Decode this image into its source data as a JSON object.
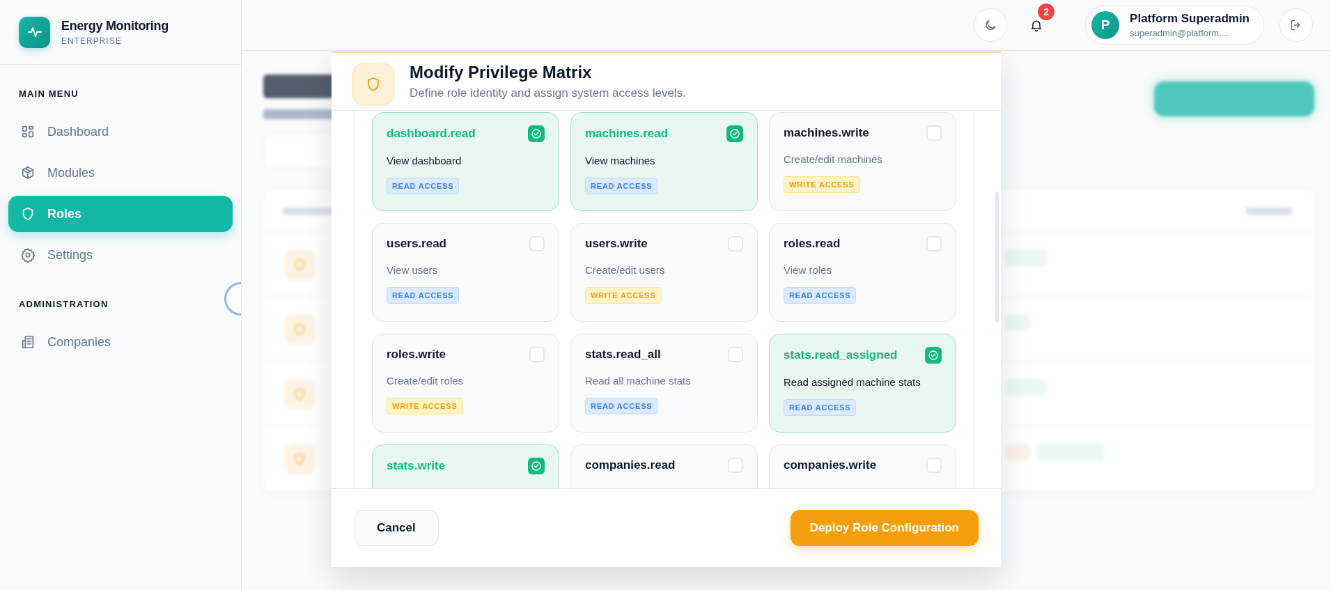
{
  "brand": {
    "title": "Energy Monitoring",
    "subtitle": "ENTERPRISE"
  },
  "sidebar": {
    "sections": [
      {
        "title": "MAIN MENU",
        "items": [
          {
            "label": "Dashboard",
            "selected": false
          },
          {
            "label": "Modules",
            "selected": false
          },
          {
            "label": "Roles",
            "selected": true
          },
          {
            "label": "Settings",
            "selected": false
          }
        ]
      },
      {
        "title": "ADMINISTRATION",
        "items": [
          {
            "label": "Companies",
            "selected": false
          }
        ]
      }
    ]
  },
  "header": {
    "notifications": "2",
    "user": {
      "initial": "P",
      "name": "Platform Superadmin",
      "email": "superadmin@platform...."
    }
  },
  "modal": {
    "title": "Modify Privilege Matrix",
    "subtitle": "Define role identity and assign system access levels.",
    "permissions": [
      {
        "name": "dashboard.read",
        "description": "View dashboard",
        "badge": "READ ACCESS",
        "kind": "read",
        "checked": true
      },
      {
        "name": "machines.read",
        "description": "View machines",
        "badge": "READ ACCESS",
        "kind": "read",
        "checked": true
      },
      {
        "name": "machines.write",
        "description": "Create/edit machines",
        "badge": "WRITE ACCESS",
        "kind": "write",
        "checked": false
      },
      {
        "name": "users.read",
        "description": "View users",
        "badge": "READ ACCESS",
        "kind": "read",
        "checked": false
      },
      {
        "name": "users.write",
        "description": "Create/edit users",
        "badge": "WRITE ACCESS",
        "kind": "write",
        "checked": false
      },
      {
        "name": "roles.read",
        "description": "View roles",
        "badge": "READ ACCESS",
        "kind": "read",
        "checked": false
      },
      {
        "name": "roles.write",
        "description": "Create/edit roles",
        "badge": "WRITE ACCESS",
        "kind": "write",
        "checked": false
      },
      {
        "name": "stats.read_all",
        "description": "Read all machine stats",
        "badge": "READ ACCESS",
        "kind": "read",
        "checked": false
      },
      {
        "name": "stats.read_assigned",
        "description": "Read assigned machine stats",
        "badge": "READ ACCESS",
        "kind": "read",
        "checked": true
      },
      {
        "name": "stats.write",
        "checked": true
      },
      {
        "name": "companies.read",
        "checked": false
      },
      {
        "name": "companies.write",
        "checked": false
      }
    ],
    "cancel": "Cancel",
    "submit": "Deploy Role Configuration"
  }
}
